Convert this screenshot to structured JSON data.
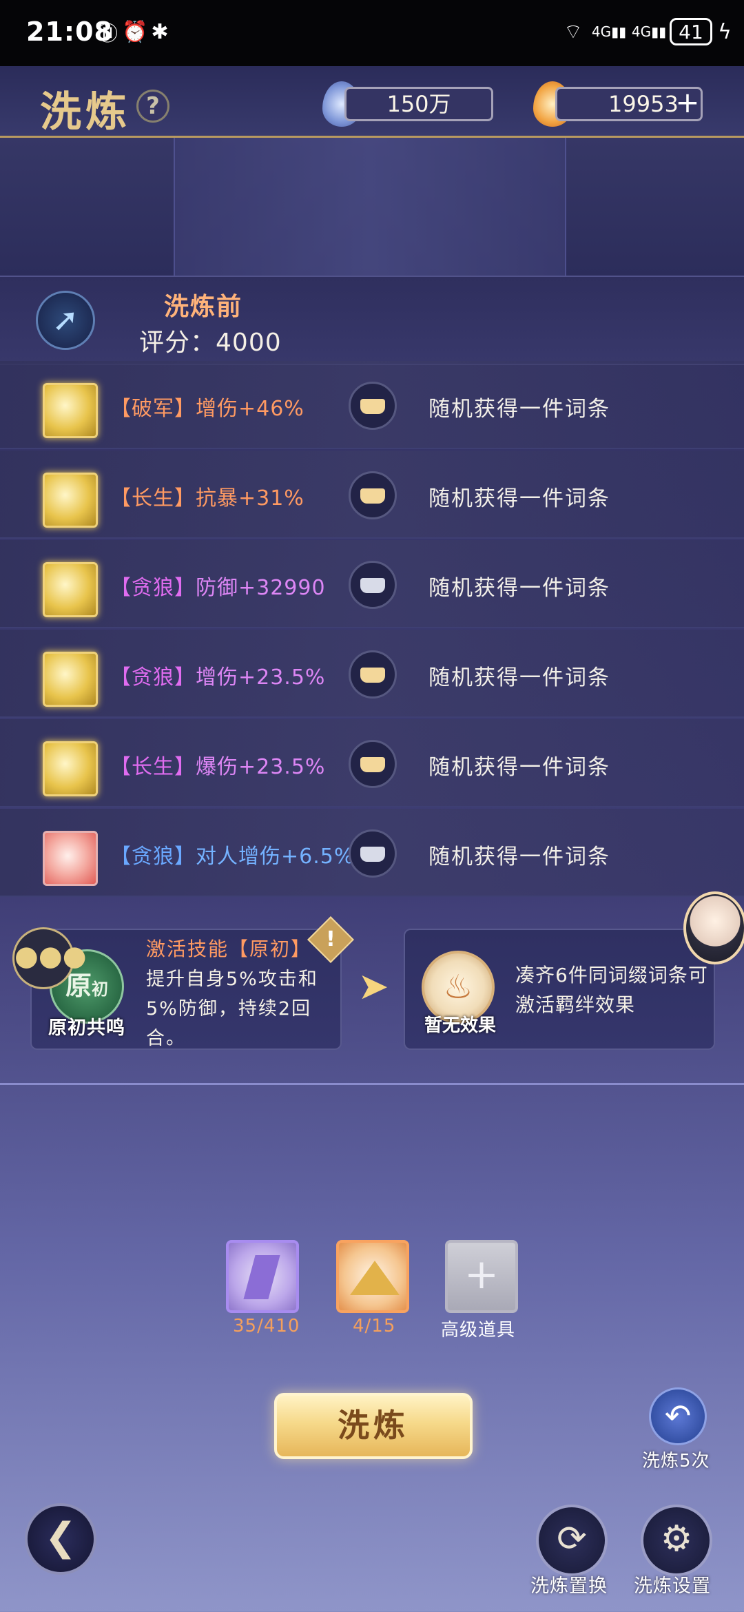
{
  "status_bar": {
    "time": "21:08",
    "battery": "41",
    "network": "4G"
  },
  "header": {
    "title": "洗炼",
    "help_symbol": "?",
    "currency_1": {
      "value": "150万",
      "icon": "blue-flame-icon"
    },
    "currency_2": {
      "value": "19953",
      "icon": "orange-flame-icon",
      "add_symbol": "+"
    }
  },
  "score": {
    "label": "洗炼前",
    "prefix": "评分：",
    "value": "4000"
  },
  "rows": [
    {
      "tag": "【破军】",
      "stat": "增伤+46%",
      "tag_color": "#ff9a62",
      "stat_color": "#ff9a62",
      "gem": "gold",
      "lock": "gold",
      "result": "随机获得一件词条"
    },
    {
      "tag": "【长生】",
      "stat": "抗暴+31%",
      "tag_color": "#ff9a62",
      "stat_color": "#ff9a62",
      "gem": "gold",
      "lock": "gold",
      "result": "随机获得一件词条"
    },
    {
      "tag": "【贪狼】",
      "stat": "防御+32990",
      "tag_color": "#e06cf0",
      "stat_color": "#dd86f5",
      "gem": "gold",
      "lock": "silver",
      "result": "随机获得一件词条"
    },
    {
      "tag": "【贪狼】",
      "stat": "增伤+23.5%",
      "tag_color": "#e06cf0",
      "stat_color": "#dd86f5",
      "gem": "gold",
      "lock": "gold",
      "result": "随机获得一件词条"
    },
    {
      "tag": "【长生】",
      "stat": "爆伤+23.5%",
      "tag_color": "#e06cf0",
      "stat_color": "#dd86f5",
      "gem": "gold",
      "lock": "gold",
      "result": "随机获得一件词条"
    },
    {
      "tag": "【贪狼】",
      "stat": "对人增伤+6.5%",
      "tag_color": "#6aa8ff",
      "stat_color": "#74b2ff",
      "gem": "red",
      "lock": "silver",
      "result": "随机获得一件词条"
    }
  ],
  "skill": {
    "icon_text": "原",
    "icon_sub": "初",
    "icon_label": "原初共鸣",
    "name": "激活技能【原初】",
    "warn_symbol": "!",
    "description": "提升自身5%攻击和5%防御，持续2回合。"
  },
  "bond": {
    "icon_label": "暂无效果",
    "description": "凑齐6件同词缀词条可激活羁绊效果"
  },
  "materials": [
    {
      "count": "35/410",
      "color": "#f5a05c"
    },
    {
      "count": "4/15",
      "color": "#f5a05c"
    },
    {
      "label": "高级道具",
      "color": "#ffffff"
    }
  ],
  "actions": {
    "wash": "洗炼",
    "wash5": "洗炼5次",
    "replace": "洗炼置换",
    "settings": "洗炼设置"
  },
  "colors": {
    "accent_gold": "#e6c98c",
    "orange_text": "#ff9a62",
    "purple_text": "#dd86f5",
    "blue_text": "#74b2ff"
  }
}
